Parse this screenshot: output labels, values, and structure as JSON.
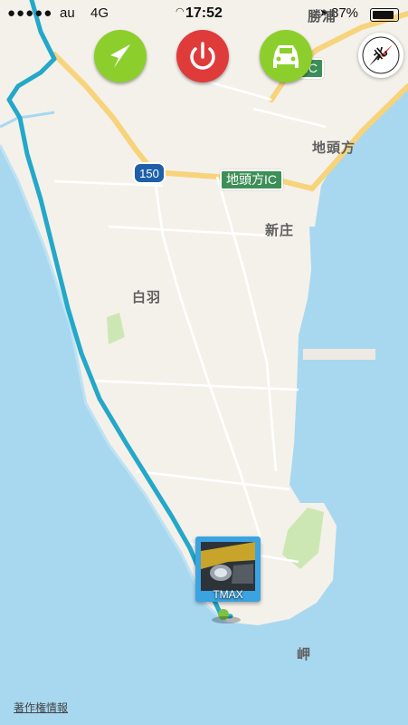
{
  "status_bar": {
    "signal_dots": "●●●●●",
    "carrier": "au",
    "network": "4G",
    "time": "17:52",
    "battery_percent": "87%"
  },
  "map_labels": {
    "katsura": "勝浦",
    "jitokata": "地頭方",
    "shinjo": "新庄",
    "shirowa": "白羽",
    "misaki": "岬"
  },
  "road_signs": {
    "route_number": "150",
    "ic_sign_main": "地頭方IC",
    "ic_sign_top": "IC"
  },
  "toolbar": {
    "navigate": "navigate-arrow-icon",
    "power": "power-icon",
    "car": "car-icon"
  },
  "compass": {
    "label": "北"
  },
  "vehicle_marker": {
    "name": "TMAX"
  },
  "footer": {
    "copyright": "著作権情報"
  },
  "colors": {
    "sea": "#a8d8f0",
    "land": "#f4f1eb",
    "route": "#23a8c9",
    "road": "#f7d37b",
    "green_button": "#8ccf2d",
    "red_button": "#e03b3b",
    "ic_sign": "#3d8f58",
    "marker_frame": "#3aa3e0"
  }
}
